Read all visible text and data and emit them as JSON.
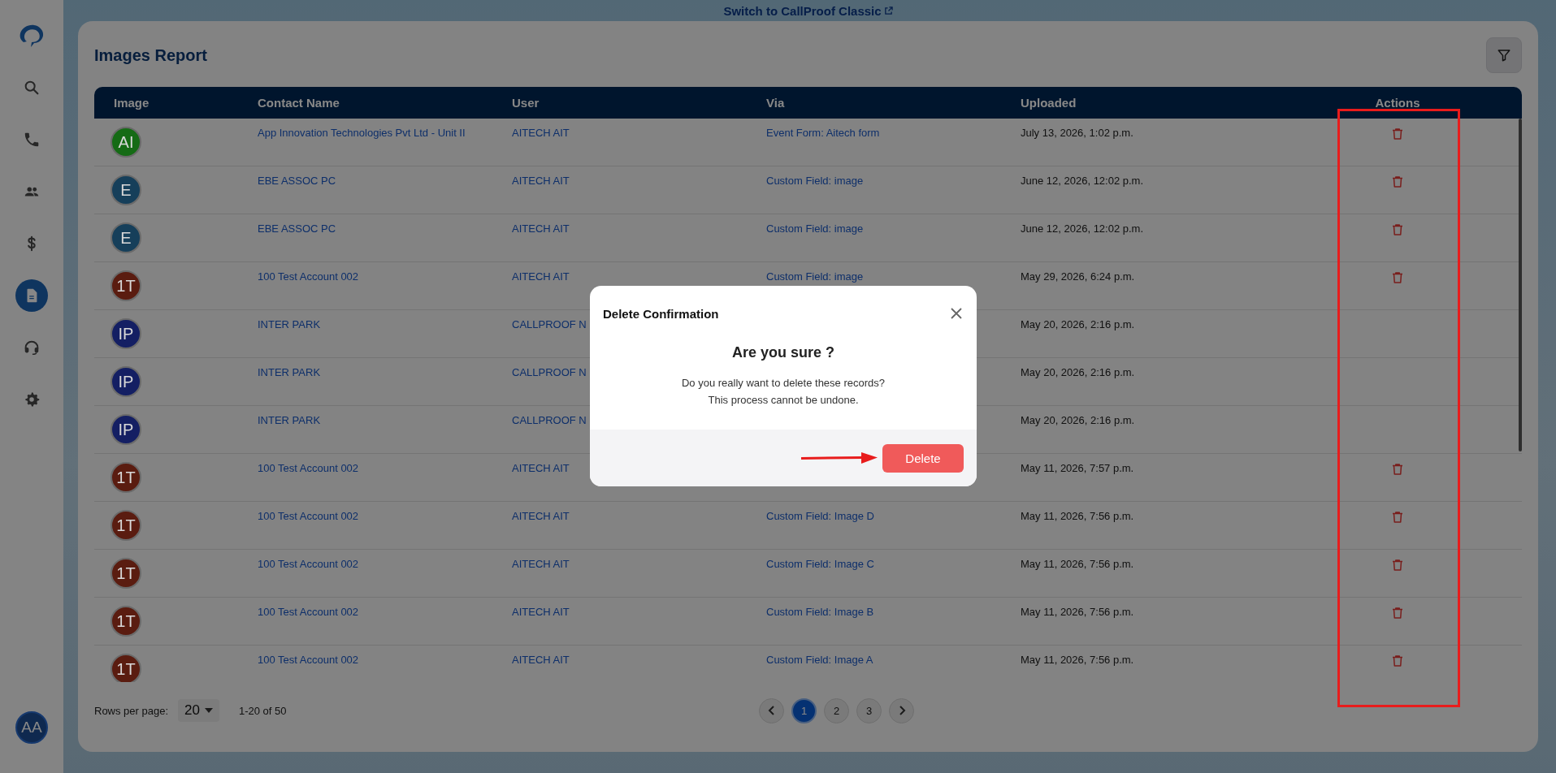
{
  "sidebar": {
    "items": [
      {
        "kind": "search",
        "selected": false
      },
      {
        "kind": "phone",
        "selected": false
      },
      {
        "kind": "people",
        "selected": false
      },
      {
        "kind": "dollar",
        "selected": false
      },
      {
        "kind": "document",
        "selected": true
      },
      {
        "kind": "headset",
        "selected": false
      },
      {
        "kind": "gear",
        "selected": false
      }
    ],
    "user_avatar": "AA"
  },
  "banner": {
    "link": "Switch to CallProof Classic"
  },
  "page": {
    "title": "Images Report"
  },
  "table": {
    "columns": [
      "Image",
      "Contact Name",
      "User",
      "Via",
      "Uploaded",
      "Actions"
    ],
    "rows": [
      {
        "initials": "AI",
        "color": "#156b15",
        "contact": "App Innovation Technologies Pvt Ltd - Unit II",
        "user": "AITECH AIT",
        "via": "Event Form: Aitech form",
        "uploaded": "July 13, 2026, 1:02 p.m.",
        "can_delete": true
      },
      {
        "initials": "E",
        "color": "#163f5a",
        "contact": "EBE ASSOC PC",
        "user": "AITECH AIT",
        "via": "Custom Field: image",
        "uploaded": "June 12, 2026, 12:02 p.m.",
        "can_delete": true
      },
      {
        "initials": "E",
        "color": "#163f5a",
        "contact": "EBE ASSOC PC",
        "user": "AITECH AIT",
        "via": "Custom Field: image",
        "uploaded": "June 12, 2026, 12:02 p.m.",
        "can_delete": true
      },
      {
        "initials": "1T",
        "color": "#5a1c10",
        "contact": "100 Test Account 002",
        "user": "AITECH AIT",
        "via": "Custom Field: image",
        "uploaded": "May 29, 2026, 6:24 p.m.",
        "can_delete": true
      },
      {
        "initials": "IP",
        "color": "#141f63",
        "contact": "INTER PARK",
        "user": "CALLPROOF N",
        "uploaded": "May 20, 2026, 2:16 p.m.",
        "can_delete": false
      },
      {
        "initials": "IP",
        "color": "#141f63",
        "contact": "INTER PARK",
        "user": "CALLPROOF N",
        "uploaded": "May 20, 2026, 2:16 p.m.",
        "can_delete": false
      },
      {
        "initials": "IP",
        "color": "#141f63",
        "contact": "INTER PARK",
        "user": "CALLPROOF N",
        "uploaded": "May 20, 2026, 2:16 p.m.",
        "can_delete": false
      },
      {
        "initials": "1T",
        "color": "#5a1c10",
        "contact": "100 Test Account 002",
        "user": "AITECH AIT",
        "uploaded": "May 11, 2026, 7:57 p.m.",
        "can_delete": true
      },
      {
        "initials": "1T",
        "color": "#5a1c10",
        "contact": "100 Test Account 002",
        "user": "AITECH AIT",
        "via": "Custom Field: Image D",
        "uploaded": "May 11, 2026, 7:56 p.m.",
        "can_delete": true
      },
      {
        "initials": "1T",
        "color": "#5a1c10",
        "contact": "100 Test Account 002",
        "user": "AITECH AIT",
        "via": "Custom Field: Image C",
        "uploaded": "May 11, 2026, 7:56 p.m.",
        "can_delete": true
      },
      {
        "initials": "1T",
        "color": "#5a1c10",
        "contact": "100 Test Account 002",
        "user": "AITECH AIT",
        "via": "Custom Field: Image B",
        "uploaded": "May 11, 2026, 7:56 p.m.",
        "can_delete": true
      },
      {
        "initials": "1T",
        "color": "#5a1c10",
        "contact": "100 Test Account 002",
        "user": "AITECH AIT",
        "via": "Custom Field: Image A",
        "uploaded": "May 11, 2026, 7:56 p.m.",
        "can_delete": true
      }
    ]
  },
  "pagination": {
    "rows_per_page_label": "Rows per page:",
    "rows_per_page": "20",
    "range": "1-20 of 50",
    "pages": [
      {
        "label": "1",
        "selected": true
      },
      {
        "label": "2",
        "selected": false
      },
      {
        "label": "3",
        "selected": false
      }
    ]
  },
  "dialog": {
    "title": "Delete Confirmation",
    "heading": "Are you sure ?",
    "lines": [
      "Do you really want to delete these records?",
      "This process cannot be undone."
    ],
    "confirm": "Delete"
  }
}
